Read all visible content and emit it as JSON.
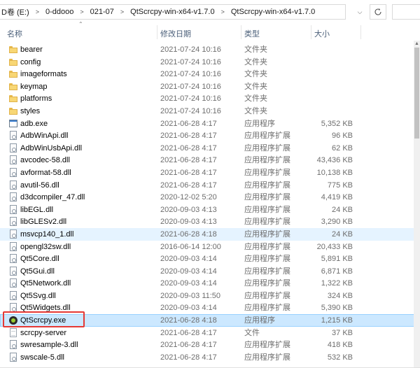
{
  "address_bar": {
    "crumbs": [
      "D卷 (E:)",
      "0-ddooo",
      "021-07",
      "QtScrcpy-win-x64-v1.7.0",
      "QtScrcpy-win-x64-v1.7.0"
    ],
    "separator": ">"
  },
  "columns": {
    "name": "名称",
    "date": "修改日期",
    "type": "类型",
    "size": "大小"
  },
  "files": [
    {
      "name": "bearer",
      "date": "2021-07-24 10:16",
      "type": "文件夹",
      "size": "",
      "icon": "folder-icon"
    },
    {
      "name": "config",
      "date": "2021-07-24 10:16",
      "type": "文件夹",
      "size": "",
      "icon": "folder-icon"
    },
    {
      "name": "imageformats",
      "date": "2021-07-24 10:16",
      "type": "文件夹",
      "size": "",
      "icon": "folder-icon"
    },
    {
      "name": "keymap",
      "date": "2021-07-24 10:16",
      "type": "文件夹",
      "size": "",
      "icon": "folder-icon"
    },
    {
      "name": "platforms",
      "date": "2021-07-24 10:16",
      "type": "文件夹",
      "size": "",
      "icon": "folder-icon"
    },
    {
      "name": "styles",
      "date": "2021-07-24 10:16",
      "type": "文件夹",
      "size": "",
      "icon": "folder-icon"
    },
    {
      "name": "adb.exe",
      "date": "2021-06-28 4:17",
      "type": "应用程序",
      "size": "5,352 KB",
      "icon": "exe-icon"
    },
    {
      "name": "AdbWinApi.dll",
      "date": "2021-06-28 4:17",
      "type": "应用程序扩展",
      "size": "96 KB",
      "icon": "dll-icon"
    },
    {
      "name": "AdbWinUsbApi.dll",
      "date": "2021-06-28 4:17",
      "type": "应用程序扩展",
      "size": "62 KB",
      "icon": "dll-icon"
    },
    {
      "name": "avcodec-58.dll",
      "date": "2021-06-28 4:17",
      "type": "应用程序扩展",
      "size": "43,436 KB",
      "icon": "dll-icon"
    },
    {
      "name": "avformat-58.dll",
      "date": "2021-06-28 4:17",
      "type": "应用程序扩展",
      "size": "10,138 KB",
      "icon": "dll-icon"
    },
    {
      "name": "avutil-56.dll",
      "date": "2021-06-28 4:17",
      "type": "应用程序扩展",
      "size": "775 KB",
      "icon": "dll-icon"
    },
    {
      "name": "d3dcompiler_47.dll",
      "date": "2020-12-02 5:20",
      "type": "应用程序扩展",
      "size": "4,419 KB",
      "icon": "dll-icon"
    },
    {
      "name": "libEGL.dll",
      "date": "2020-09-03 4:13",
      "type": "应用程序扩展",
      "size": "24 KB",
      "icon": "dll-icon"
    },
    {
      "name": "libGLESv2.dll",
      "date": "2020-09-03 4:13",
      "type": "应用程序扩展",
      "size": "3,290 KB",
      "icon": "dll-icon"
    },
    {
      "name": "msvcp140_1.dll",
      "date": "2021-06-28 4:18",
      "type": "应用程序扩展",
      "size": "24 KB",
      "icon": "dll-icon",
      "state": "hovered"
    },
    {
      "name": "opengl32sw.dll",
      "date": "2016-06-14 12:00",
      "type": "应用程序扩展",
      "size": "20,433 KB",
      "icon": "dll-icon"
    },
    {
      "name": "Qt5Core.dll",
      "date": "2020-09-03 4:14",
      "type": "应用程序扩展",
      "size": "5,891 KB",
      "icon": "dll-icon"
    },
    {
      "name": "Qt5Gui.dll",
      "date": "2020-09-03 4:14",
      "type": "应用程序扩展",
      "size": "6,871 KB",
      "icon": "dll-icon"
    },
    {
      "name": "Qt5Network.dll",
      "date": "2020-09-03 4:14",
      "type": "应用程序扩展",
      "size": "1,322 KB",
      "icon": "dll-icon"
    },
    {
      "name": "Qt5Svg.dll",
      "date": "2020-09-03 11:50",
      "type": "应用程序扩展",
      "size": "324 KB",
      "icon": "dll-icon"
    },
    {
      "name": "Qt5Widgets.dll",
      "date": "2020-09-03 4:14",
      "type": "应用程序扩展",
      "size": "5,390 KB",
      "icon": "dll-icon"
    },
    {
      "name": "QtScrcpy.exe",
      "date": "2021-06-28 4:18",
      "type": "应用程序",
      "size": "1,215 KB",
      "icon": "qtscrcpy-app-icon",
      "state": "selected",
      "highlighted": true
    },
    {
      "name": "scrcpy-server",
      "date": "2021-06-28 4:17",
      "type": "文件",
      "size": "37 KB",
      "icon": "file-icon"
    },
    {
      "name": "swresample-3.dll",
      "date": "2021-06-28 4:17",
      "type": "应用程序扩展",
      "size": "418 KB",
      "icon": "dll-icon"
    },
    {
      "name": "swscale-5.dll",
      "date": "2021-06-28 4:17",
      "type": "应用程序扩展",
      "size": "532 KB",
      "icon": "dll-icon"
    }
  ],
  "colors": {
    "selection": "#cce8ff",
    "hover": "#e5f3ff",
    "highlight_box": "#e53935",
    "folder": "#f8d775"
  }
}
